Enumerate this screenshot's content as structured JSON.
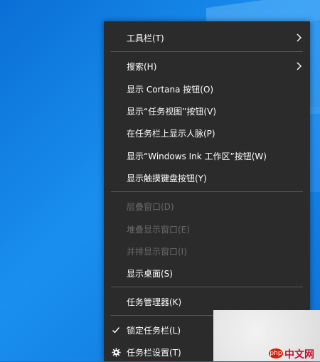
{
  "menu": {
    "items": [
      {
        "label": "工具栏(T)"
      },
      {
        "label": "搜索(H)"
      },
      {
        "label": "显示 Cortana 按钮(O)"
      },
      {
        "label": "显示“任务视图”按钮(V)"
      },
      {
        "label": "在任务栏上显示人脉(P)"
      },
      {
        "label": "显示“Windows Ink 工作区”按钮(W)"
      },
      {
        "label": "显示触摸键盘按钮(Y)"
      },
      {
        "label": "层叠窗口(D)"
      },
      {
        "label": "堆叠显示窗口(E)"
      },
      {
        "label": "并排显示窗口(I)"
      },
      {
        "label": "显示桌面(S)"
      },
      {
        "label": "任务管理器(K)"
      },
      {
        "label": "锁定任务栏(L)"
      },
      {
        "label": "任务栏设置(T)"
      }
    ]
  },
  "watermark": {
    "badge": "php",
    "text": "中文网"
  },
  "colors": {
    "menu_bg": "#2b2b2b",
    "text": "#ffffff",
    "disabled_text": "#6a6a6a",
    "separator": "#555555",
    "desktop": "#1a8ff0"
  },
  "icons": {
    "submenu": "chevron-right-icon",
    "checked": "checkmark-icon",
    "settings": "gear-icon"
  }
}
